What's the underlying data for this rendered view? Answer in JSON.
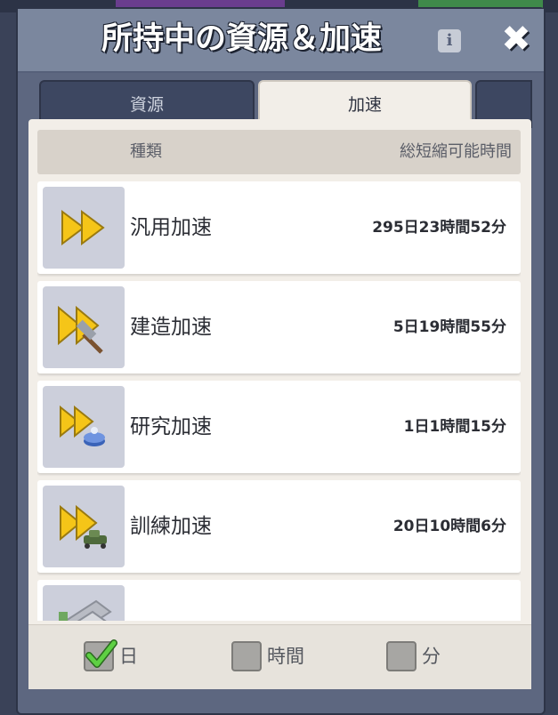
{
  "window": {
    "title": "所持中の資源＆加速",
    "info_icon": "info-icon",
    "close_icon": "close-icon"
  },
  "tabs": [
    {
      "label": "資源",
      "active": false
    },
    {
      "label": "加速",
      "active": true
    }
  ],
  "list": {
    "header_type": "種類",
    "header_time": "総短縮可能時間",
    "items": [
      {
        "label": "汎用加速",
        "value": "295日23時間52分",
        "icon": "speedup-icon"
      },
      {
        "label": "建造加速",
        "value": "5日19時間55分",
        "icon": "building-speedup-icon"
      },
      {
        "label": "研究加速",
        "value": "1日1時間15分",
        "icon": "research-speedup-icon"
      },
      {
        "label": "訓練加速",
        "value": "20日10時間6分",
        "icon": "training-speedup-icon"
      },
      {
        "label": "",
        "value": "",
        "icon": "partially-hidden-item-icon"
      }
    ]
  },
  "filters": [
    {
      "label": "日",
      "checked": true
    },
    {
      "label": "時間",
      "checked": false
    },
    {
      "label": "分",
      "checked": false
    }
  ],
  "colors": {
    "accent_yellow": "#f5c518",
    "check_green": "#4fc33a",
    "panel_bg": "#f2eee8",
    "frame_bg": "#5d6780"
  }
}
